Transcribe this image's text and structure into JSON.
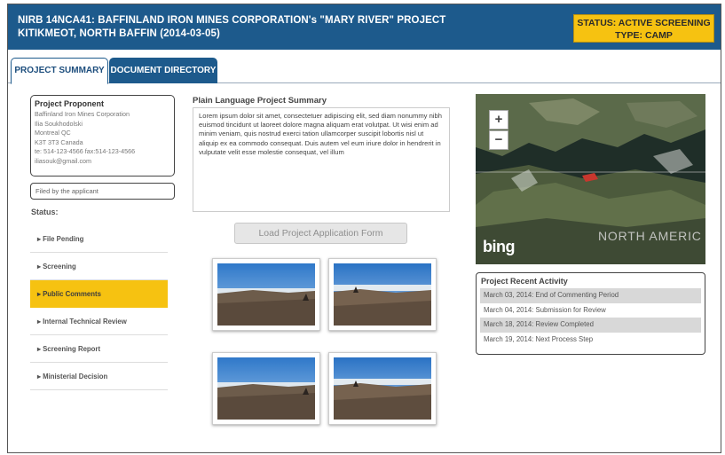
{
  "header": {
    "title_line1": "NIRB 14NCA41: BAFFINLAND IRON MINES CORPORATION's \"MARY RIVER\" PROJECT",
    "title_line2": "KITIKMEOT, NORTH BAFFIN (2014-03-05)",
    "status_line": "STATUS: ACTIVE SCREENING",
    "type_line": "TYPE: CAMP"
  },
  "tabs": [
    {
      "label": "PROJECT SUMMARY"
    },
    {
      "label": "DOCUMENT DIRECTORY"
    }
  ],
  "proponent": {
    "heading": "Project Proponent",
    "lines": [
      "Baffinland Iron Mines Corporation",
      "Ilia Soukhodolski",
      "Montreal QC",
      "K3T 3T3 Canada",
      "te: 514-123-4566 fax:514-123-4566",
      "iliasouk@gmail.com"
    ]
  },
  "filed_by": "Filed by the applicant",
  "status_label": "Status:",
  "stages": [
    {
      "label": "▸ File Pending"
    },
    {
      "label": "▸ Screening"
    },
    {
      "label": "▸ Public Comments"
    },
    {
      "label": "▸ Internal Technical Review"
    },
    {
      "label": "▸ Screening Report"
    },
    {
      "label": "▸ Ministerial Decision"
    }
  ],
  "plain_language": {
    "heading": "Plain Language Project Summary",
    "text": "Lorem ipsum dolor sit amet, consectetuer adipiscing elit, sed diam nonummy nibh euismod tincidunt ut laoreet dolore magna aliquam erat volutpat. Ut wisi enim ad minim veniam, quis nostrud exerci tation ullamcorper suscipit lobortis nisl ut aliquip ex ea commodo consequat. Duis autem vel eum iriure dolor in hendrerit in vulputate velit esse molestie consequat, vel illum"
  },
  "load_button": "Load Project Application Form",
  "map": {
    "zoom_in": "+",
    "zoom_out": "−",
    "provider": "bing",
    "region_label": "NORTH AMERIC"
  },
  "activity": {
    "heading": "Project Recent Activity",
    "items": [
      {
        "text": "March 03, 2014: End of Commenting Period"
      },
      {
        "text": "March 04, 2014: Submission for Review"
      },
      {
        "text": "March 18, 2014: Review Completed"
      },
      {
        "text": "March 19, 2014: Next Process Step"
      }
    ]
  },
  "colors": {
    "header_blue": "#1d5a8c",
    "status_yellow": "#f6c211"
  }
}
